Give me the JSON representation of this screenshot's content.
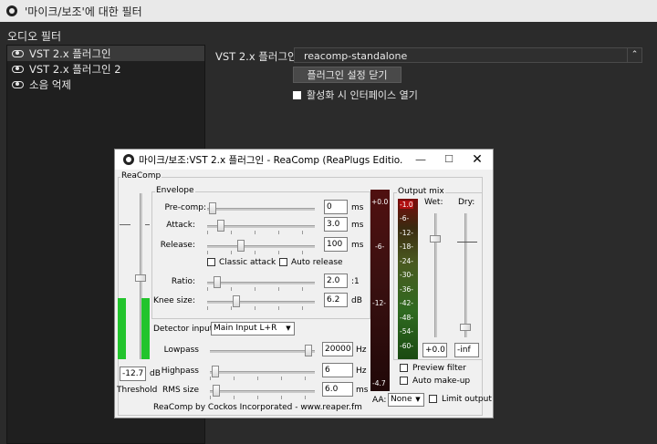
{
  "window": {
    "title": "'마이크/보조'에 대한 필터"
  },
  "filters_panel": {
    "label": "오디오 필터",
    "items": [
      {
        "label": "VST 2.x 플러그인",
        "selected": true
      },
      {
        "label": "VST 2.x 플러그인 2",
        "selected": false
      },
      {
        "label": "소음 억제",
        "selected": false
      }
    ]
  },
  "properties": {
    "vst_label": "VST 2.x 플러그인",
    "plugin_selected": "reacomp-standalone",
    "close_settings_button": "플러그인 설정 닫기",
    "open_interface_checkbox": "활성화 시 인터페이스 열기",
    "open_interface_checked": false
  },
  "plugin": {
    "title": "마이크/보조:VST 2.x 플러그인 - ReaComp (ReaPlugs Editio...",
    "group_reacomp": "ReaComp",
    "group_envelope": "Envelope",
    "group_output": "Output mix",
    "precomp": {
      "label": "Pre-comp:",
      "value": "0",
      "unit": "ms",
      "pos": 0.02
    },
    "attack": {
      "label": "Attack:",
      "value": "3.0",
      "unit": "ms",
      "pos": 0.1
    },
    "release": {
      "label": "Release:",
      "value": "100",
      "unit": "ms",
      "pos": 0.3
    },
    "classic_attack": "Classic attack",
    "auto_release": "Auto release",
    "ratio": {
      "label": "Ratio:",
      "value": "2.0",
      "unit": ":1",
      "pos": 0.06
    },
    "knee": {
      "label": "Knee size:",
      "value": "6.2",
      "unit": "dB",
      "pos": 0.25
    },
    "detector_label": "Detector input:",
    "detector_value": "Main Input L+R",
    "lowpass": {
      "label": "Lowpass",
      "value": "20000",
      "unit": "Hz",
      "pos": 0.97
    },
    "highpass": {
      "label": "Highpass",
      "value": "6",
      "unit": "Hz",
      "pos": 0.02
    },
    "rms": {
      "label": "RMS size",
      "value": "6.0",
      "unit": "ms",
      "pos": 0.03
    },
    "threshold_value": "-12.7",
    "threshold_unit": "dB",
    "threshold_label": "Threshold",
    "threshold_level": 0.45,
    "center_meter_labels": [
      "+0.0",
      "-6-",
      "-12-",
      "-4.7"
    ],
    "output_meter_labels": [
      "-1.0",
      "-6-",
      "-12-",
      "-18-",
      "-24-",
      "-30-",
      "-36-",
      "-42-",
      "-48-",
      "-54-",
      "-60-"
    ],
    "wet_label": "Wet:",
    "dry_label": "Dry:",
    "wet_value": "+0.0",
    "dry_value": "-inf",
    "preview_filter": "Preview filter",
    "auto_makeup": "Auto make-up",
    "aa_label": "AA:",
    "aa_value": "None",
    "limit_output": "Limit output",
    "footer": "ReaComp by Cockos Incorporated - www.reaper.fm"
  }
}
